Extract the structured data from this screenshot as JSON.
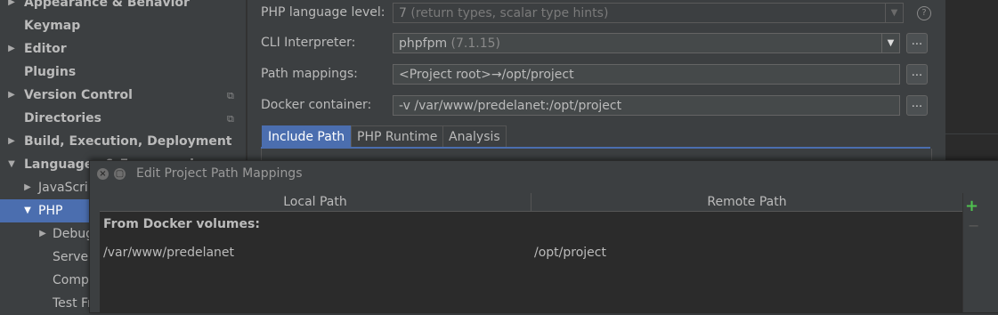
{
  "sidebar": {
    "items": [
      {
        "label": "Appearance & Behavior",
        "arrow": "▶",
        "bold": true
      },
      {
        "label": "Keymap",
        "bold": true
      },
      {
        "label": "Editor",
        "arrow": "▶",
        "bold": true
      },
      {
        "label": "Plugins",
        "bold": true
      },
      {
        "label": "Version Control",
        "arrow": "▶",
        "bold": true,
        "copy_icon": true
      },
      {
        "label": "Directories",
        "bold": true,
        "copy_icon": true
      },
      {
        "label": "Build, Execution, Deployment",
        "arrow": "▶",
        "bold": true
      },
      {
        "label": "Languages & Frameworks",
        "arrow": "▼",
        "bold": true
      },
      {
        "label": "JavaScript",
        "arrow": "▶"
      },
      {
        "label": "PHP",
        "arrow": "▼",
        "selected": true
      },
      {
        "label": "Debug",
        "arrow": "▶"
      },
      {
        "label": "Servers"
      },
      {
        "label": "Composer"
      },
      {
        "label": "Test Frameworks"
      }
    ],
    "copy_glyph": "⧉",
    "selected_color": "#4b6eaf"
  },
  "settings": {
    "php_level_label": "PHP language level:",
    "php_level_value": "7",
    "php_level_hint": " (return types, scalar type hints)",
    "cli_label": "CLI Interpreter:",
    "cli_value": "phpfpm",
    "cli_version": " (7.1.15)",
    "path_mappings_label": "Path mappings:",
    "path_mappings_value": "<Project root>→/opt/project",
    "docker_label": "Docker container:",
    "docker_value": "-v /var/www/predelanet:/opt/project",
    "browse_label": "...",
    "dropdown_arrow": "▼",
    "help_glyph": "?"
  },
  "tabs": [
    {
      "label": "Include Path",
      "active": true
    },
    {
      "label": "PHP Runtime"
    },
    {
      "label": "Analysis"
    }
  ],
  "dialog": {
    "title": "Edit Project Path Mappings",
    "close_glyph": "×",
    "restore_glyph": "▢",
    "columns": [
      "Local Path",
      "Remote Path"
    ],
    "group_label": "From Docker volumes:",
    "rows": [
      {
        "local": "/var/www/predelanet",
        "remote": "/opt/project"
      }
    ],
    "add_glyph": "+",
    "remove_glyph": "−",
    "add_color": "#4fc14f"
  }
}
